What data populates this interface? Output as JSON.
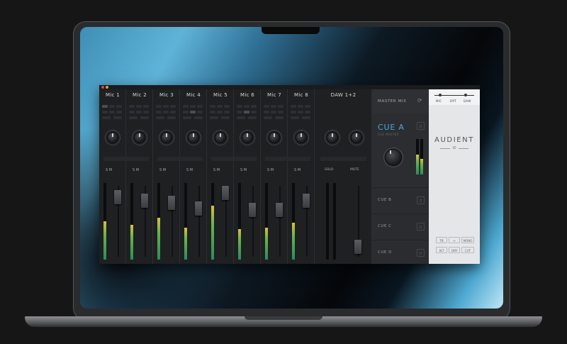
{
  "mixer": {
    "channels": [
      {
        "name": "Mic 1",
        "fader_level": 0.42,
        "meter_level": 0.5
      },
      {
        "name": "Mic 2",
        "fader_level": 0.36,
        "meter_level": 0.45
      },
      {
        "name": "Mic 3",
        "fader_level": 0.32,
        "meter_level": 0.55
      },
      {
        "name": "Mic 4",
        "fader_level": 0.23,
        "meter_level": 0.42
      },
      {
        "name": "Mic 5",
        "fader_level": 0.5,
        "meter_level": 0.7
      },
      {
        "name": "Mic 6",
        "fader_level": 0.2,
        "meter_level": 0.4
      },
      {
        "name": "Mic 7",
        "fader_level": 0.2,
        "meter_level": 0.42
      },
      {
        "name": "Mic 8",
        "fader_level": 0.36,
        "meter_level": 0.48
      }
    ],
    "daw": {
      "name": "DAW 1+2",
      "solo_label": "SOLO",
      "mute_label": "MUTE",
      "fader_level": 0.05,
      "meter_level": 0.0
    }
  },
  "master": {
    "title": "MASTER MIX",
    "cue_active": {
      "title": "CUE A",
      "subtitle": "CUE MASTER"
    },
    "cues": [
      {
        "label": "CUE B"
      },
      {
        "label": "CUE C"
      },
      {
        "label": "CUE D"
      }
    ]
  },
  "id_panel": {
    "switch": [
      "MIC",
      "DPT",
      "DAW"
    ],
    "brand": "AUDIENT",
    "brand_sub": "iD",
    "buttons": [
      "TB",
      "↔",
      "MONO",
      "ALT",
      "DIM",
      "CUT"
    ]
  },
  "colors": {
    "accent": "#4aa8e0",
    "meter_green": "#2e8b5a",
    "meter_yellow": "#d9c23a"
  }
}
